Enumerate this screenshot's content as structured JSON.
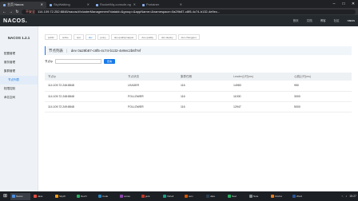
{
  "browser": {
    "tabs": [
      {
        "label": "主页 Nacos",
        "active": true
      },
      {
        "label": "SkyWalking",
        "active": false
      },
      {
        "label": "RocketMq-console-ng",
        "active": false
      },
      {
        "label": "Portainer",
        "active": false
      }
    ],
    "window_controls": [
      "–",
      "□",
      "✕"
    ],
    "url_warning": "不安全",
    "url": "114.109.72.252:8848/nacos/#/clusterManagement?dataId=&group=&appName=&namespace=0a29b87-c8f5-4c74-b132-4e9ec..."
  },
  "header": {
    "logo": "NACOS.",
    "links": [
      "首页",
      "文档",
      "博客",
      "社区"
    ],
    "user": "nacos"
  },
  "sidebar": {
    "version": "NACOS 1.2.1",
    "items": [
      {
        "label": "配置管理",
        "sub": false,
        "active": false
      },
      {
        "label": "服务管理",
        "sub": false,
        "active": false
      },
      {
        "label": "集群管理",
        "sub": false,
        "active": false
      },
      {
        "label": "节点列表",
        "sub": true,
        "active": true
      },
      {
        "label": "权限控制",
        "sub": false,
        "active": false
      },
      {
        "label": "命名空间",
        "sub": false,
        "active": false
      }
    ]
  },
  "main": {
    "namespaces": [
      {
        "label": "public",
        "active": false
      },
      {
        "label": "online",
        "active": false
      },
      {
        "label": "test",
        "active": false
      },
      {
        "label": "dev",
        "active": true
      },
      {
        "label": "jenny",
        "active": false
      },
      {
        "label": "dev-qualitymapper",
        "active": false
      },
      {
        "label": "dev-quality",
        "active": false
      },
      {
        "label": "dev-deploy",
        "active": false
      },
      {
        "label": "dev-changqun",
        "active": false
      }
    ],
    "title": "节点列表",
    "separator": "|",
    "namespace_info": "dev  0a29b87-c8f5-4c74-b132-4e9ec2b6f7ef",
    "filter": {
      "label": "节点Ip",
      "placeholder": "",
      "button": "查询"
    },
    "table": {
      "columns": [
        "节点Ip",
        "节点状态",
        "集群任期",
        "Leader止时(ms)",
        "心跳止时(ms)"
      ],
      "rows": [
        [
          "114.109.72.246:8848",
          "LEADER",
          "116",
          "14983",
          "950"
        ],
        [
          "114.109.72.248:8848",
          "FOLLOWER",
          "116",
          "11000",
          "3000"
        ],
        [
          "114.109.72.249:8848",
          "FOLLOWER",
          "116",
          "12947",
          "5000"
        ]
      ]
    }
  },
  "taskbar": {
    "items": [
      {
        "label": "Nacos",
        "active": true,
        "color": "#4a90e2"
      },
      {
        "label": "Java",
        "active": false,
        "color": "#e74c3c"
      },
      {
        "label": "SkyW",
        "active": false,
        "color": "#f39c12"
      },
      {
        "label": "DevO",
        "active": false,
        "color": "#27ae60"
      },
      {
        "label": "Code",
        "active": false,
        "color": "#2980b9"
      },
      {
        "label": "conso",
        "active": false,
        "color": "#8e44ad"
      },
      {
        "label": "jenk",
        "active": false,
        "color": "#c0392b"
      },
      {
        "label": "Xshell",
        "active": false,
        "color": "#16a085"
      },
      {
        "label": "serv",
        "active": false,
        "color": "#d35400"
      },
      {
        "label": "data",
        "active": false,
        "color": "#2c3e50"
      },
      {
        "label": "Navi",
        "active": false,
        "color": "#27ae60"
      },
      {
        "label": "Note",
        "active": false,
        "color": "#7f8c8d"
      },
      {
        "label": "Firefox",
        "active": false,
        "color": "#e67e22"
      },
      {
        "label": "Word",
        "active": false,
        "color": "#2b579a"
      }
    ],
    "time": "15:27"
  }
}
